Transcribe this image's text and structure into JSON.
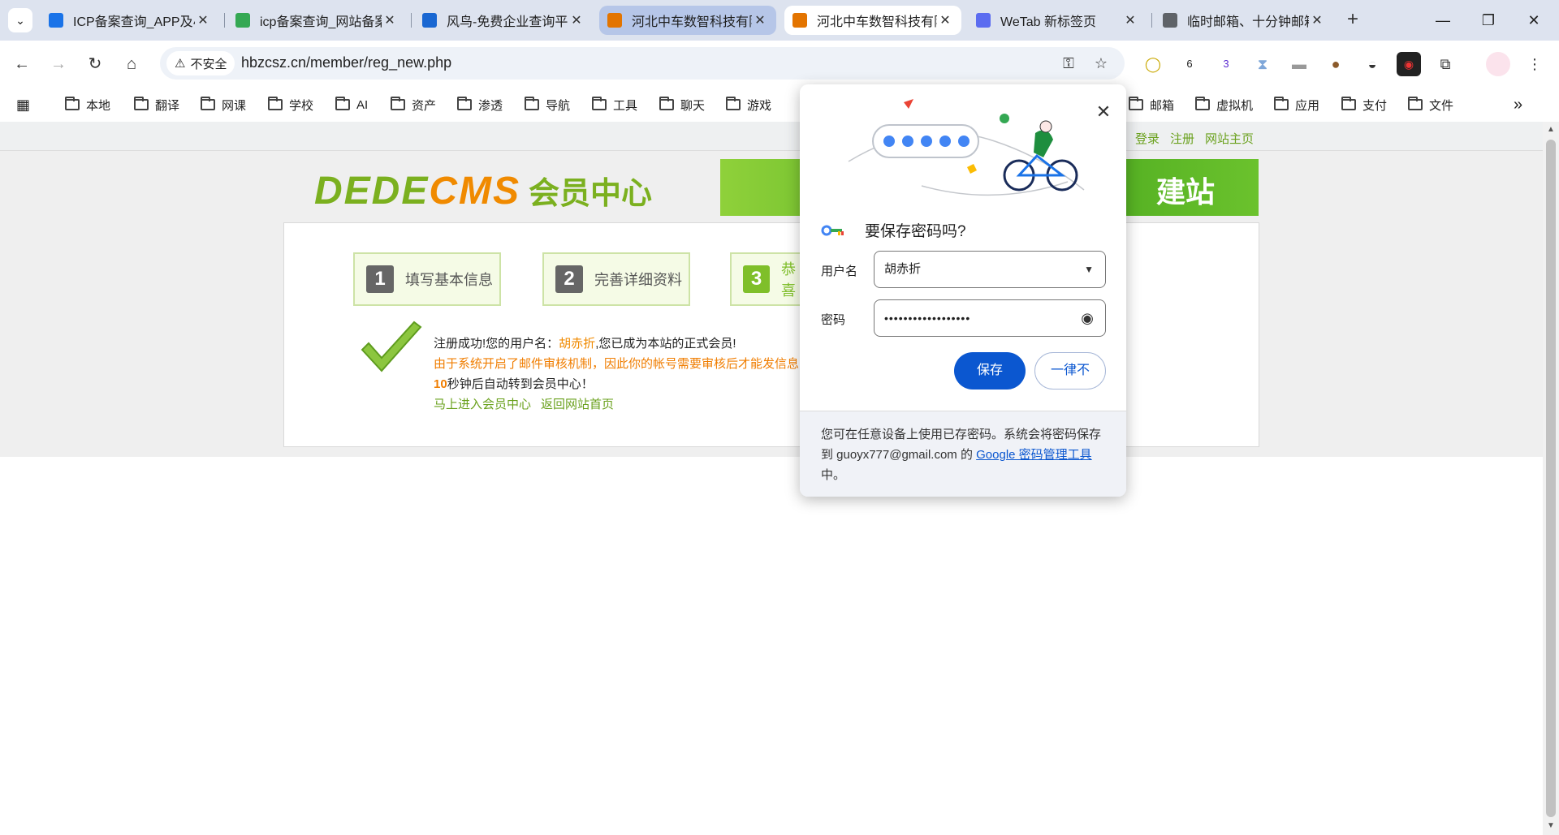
{
  "tabs": [
    {
      "title": "ICP备案查询_APP及小",
      "color": "#1a73e8"
    },
    {
      "title": "icp备案查询_网站备案",
      "color": "#34a853"
    },
    {
      "title": "风鸟-免费企业查询平",
      "color": "#1967d2"
    },
    {
      "title": "河北中车数智科技有限",
      "color": "#e37400"
    },
    {
      "title": "河北中车数智科技有限",
      "color": "#e37400"
    },
    {
      "title": "WeTab 新标签页",
      "color": "#5b6cf0"
    },
    {
      "title": "临时邮箱、十分钟邮箱",
      "color": "#5f6368"
    }
  ],
  "tab_close": "✕",
  "new_tab": "+",
  "window": {
    "minimize": "—",
    "restore": "❐",
    "close": "✕"
  },
  "toolbar": {
    "security_label": "不安全",
    "url": "hbzcsz.cn/member/reg_new.php",
    "ext_badge_1": "6",
    "ext_badge_2": "3"
  },
  "bookmarks": [
    "本地",
    "翻译",
    "网课",
    "学校",
    "AI",
    "资产",
    "渗透",
    "导航",
    "工具",
    "聊天",
    "游戏",
    "邮箱",
    "虚拟机",
    "应用",
    "支付",
    "文件"
  ],
  "page": {
    "top_links": [
      "登录",
      "注册",
      "网站主页"
    ],
    "logo_main": "DEDE",
    "logo_cms": "CMS",
    "logo_sub": "会员中心",
    "banner_text": "建站",
    "steps": [
      {
        "num": "1",
        "label": "填写基本信息"
      },
      {
        "num": "2",
        "label": "完善详细资料"
      },
      {
        "num": "3",
        "label": "恭喜"
      }
    ],
    "msg_prefix": "注册成功!您的用户名：",
    "msg_username": "胡赤折",
    "msg_suffix": ",您已成为本站的正式会员!",
    "msg_audit": "由于系统开启了邮件审核机制，因此你的帐号需要审核后才能发信息",
    "msg_count": "10",
    "msg_redirect": "秒钟后自动转到会员中心！",
    "link_member": "马上进入会员中心",
    "link_home": "返回网站首页"
  },
  "popup": {
    "title": "要保存密码吗?",
    "username_label": "用户名",
    "username_value": "胡赤折",
    "password_label": "密码",
    "password_value": "••••••••••••••••••",
    "save_label": "保存",
    "never_label": "一律不",
    "footer_text_1": "您可在任意设备上使用已存密码。系统会将密码保存到 guoyx777@gmail.com 的 ",
    "footer_link": "Google 密码管理工具",
    "footer_text_2": "中。"
  }
}
